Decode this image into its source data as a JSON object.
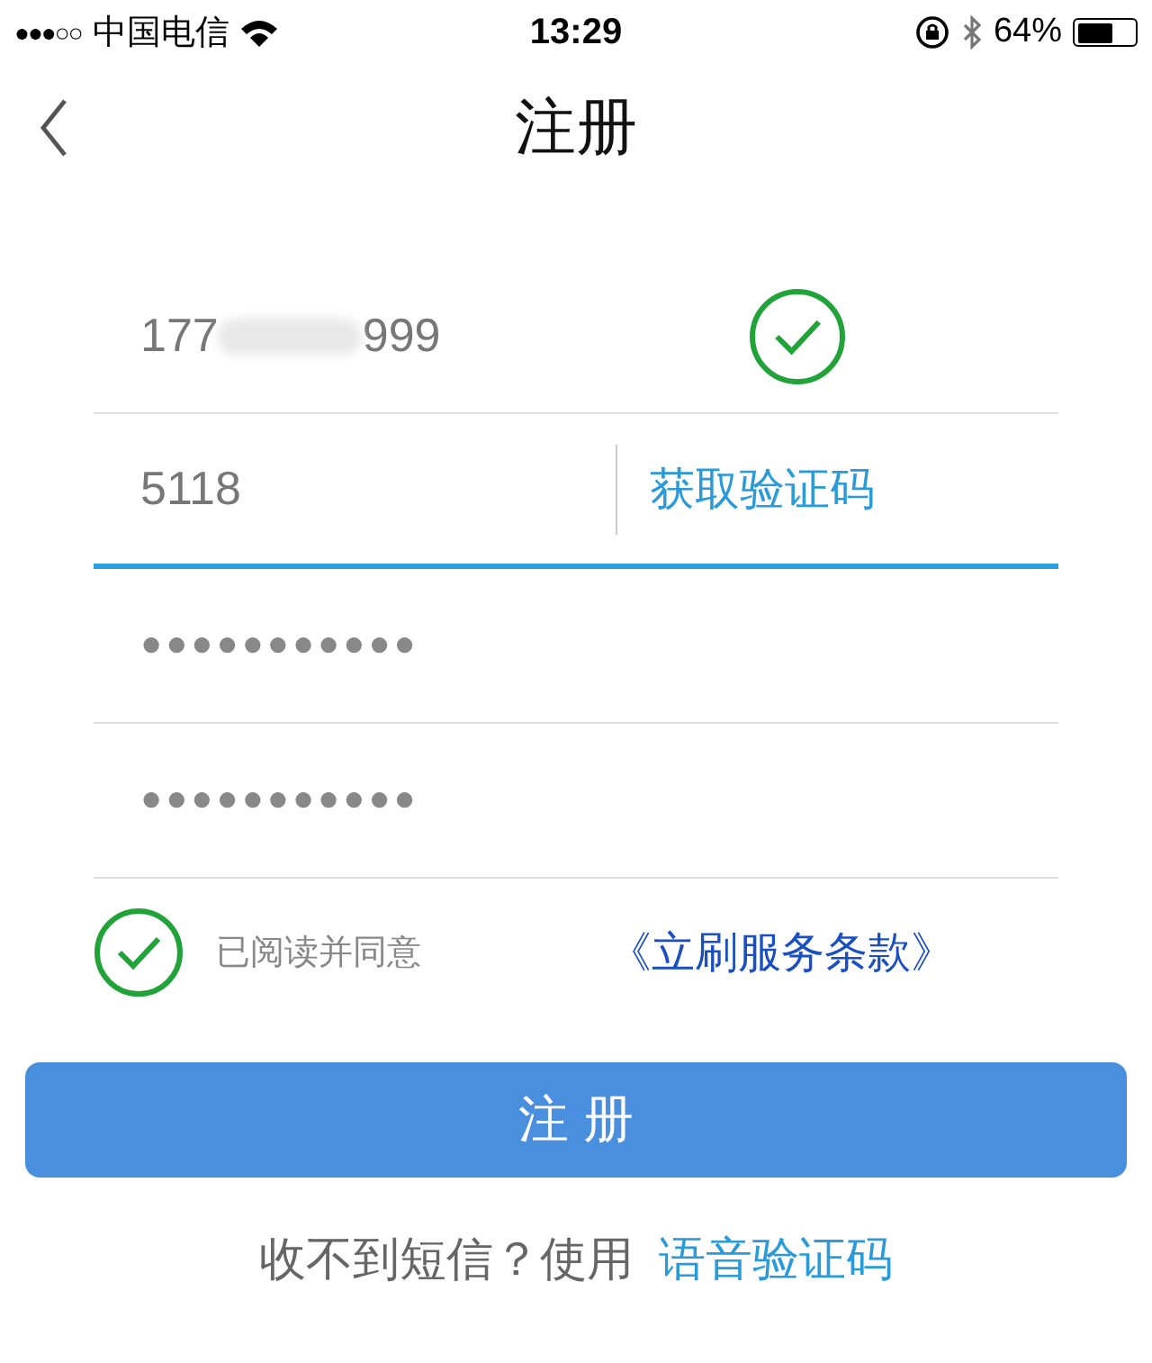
{
  "status_bar": {
    "signal": "●●●○○",
    "carrier": "中国电信",
    "time": "13:29",
    "battery_percent": "64%"
  },
  "nav": {
    "title": "注册"
  },
  "phone": {
    "value_start": "177",
    "value_end": "999",
    "valid": true
  },
  "code": {
    "value": "5118",
    "button": "获取验证码",
    "focused": true
  },
  "passwords": [
    {
      "value": "●●●●●●●●●●●"
    },
    {
      "value": "●●●●●●●●●●●"
    }
  ],
  "agreement": {
    "checked": true,
    "text": "已阅读并同意",
    "link": "《立刷服务条款》"
  },
  "submit": "注 册",
  "footer": {
    "text": "收不到短信？使用",
    "link": "语音验证码"
  }
}
